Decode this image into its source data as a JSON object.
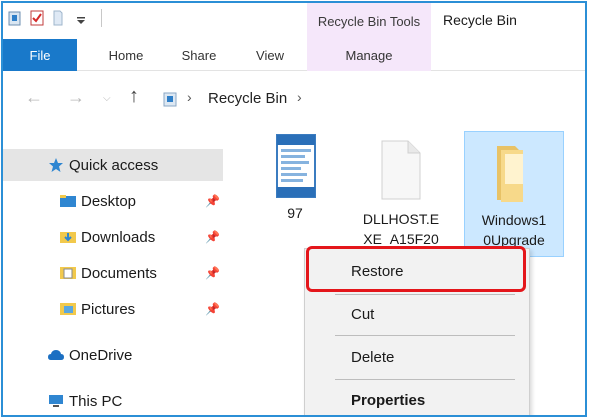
{
  "window": {
    "title": "Recycle Bin",
    "contextual_group": "Recycle Bin Tools"
  },
  "ribbon": {
    "tabs": [
      {
        "label": "File",
        "active": true
      },
      {
        "label": "Home"
      },
      {
        "label": "Share"
      },
      {
        "label": "View"
      },
      {
        "label": "Manage"
      }
    ]
  },
  "address": {
    "breadcrumb": [
      "Recycle Bin"
    ]
  },
  "navpane": {
    "items": [
      {
        "label": "Quick access",
        "icon": "star-icon",
        "selected": true
      },
      {
        "label": "Desktop",
        "icon": "folder-icon",
        "pinned": true
      },
      {
        "label": "Downloads",
        "icon": "download-folder-icon",
        "pinned": true
      },
      {
        "label": "Documents",
        "icon": "documents-folder-icon",
        "pinned": true
      },
      {
        "label": "Pictures",
        "icon": "pictures-folder-icon",
        "pinned": true
      },
      {
        "label": "OneDrive",
        "icon": "cloud-icon"
      },
      {
        "label": "This PC",
        "icon": "computer-icon"
      }
    ]
  },
  "files": [
    {
      "name_line1": "97",
      "name_line2": "",
      "icon": "document-icon"
    },
    {
      "name_line1": "DLLHOST.E",
      "name_line2": "XE_A15F20",
      "icon": "blank-file-icon"
    },
    {
      "name_line1": "Windows1",
      "name_line2": "0Upgrade",
      "icon": "folder-icon",
      "selected": true
    }
  ],
  "context_menu": {
    "items": [
      {
        "label": "Restore",
        "highlighted": true
      },
      {
        "label": "Cut"
      },
      {
        "label": "Delete"
      },
      {
        "label": "Properties",
        "bold": true
      }
    ]
  },
  "colors": {
    "accent": "#1979ca",
    "contextual_tab": "#f5e7fa",
    "highlight_border": "#e4161b",
    "selection": "#cce8ff"
  }
}
